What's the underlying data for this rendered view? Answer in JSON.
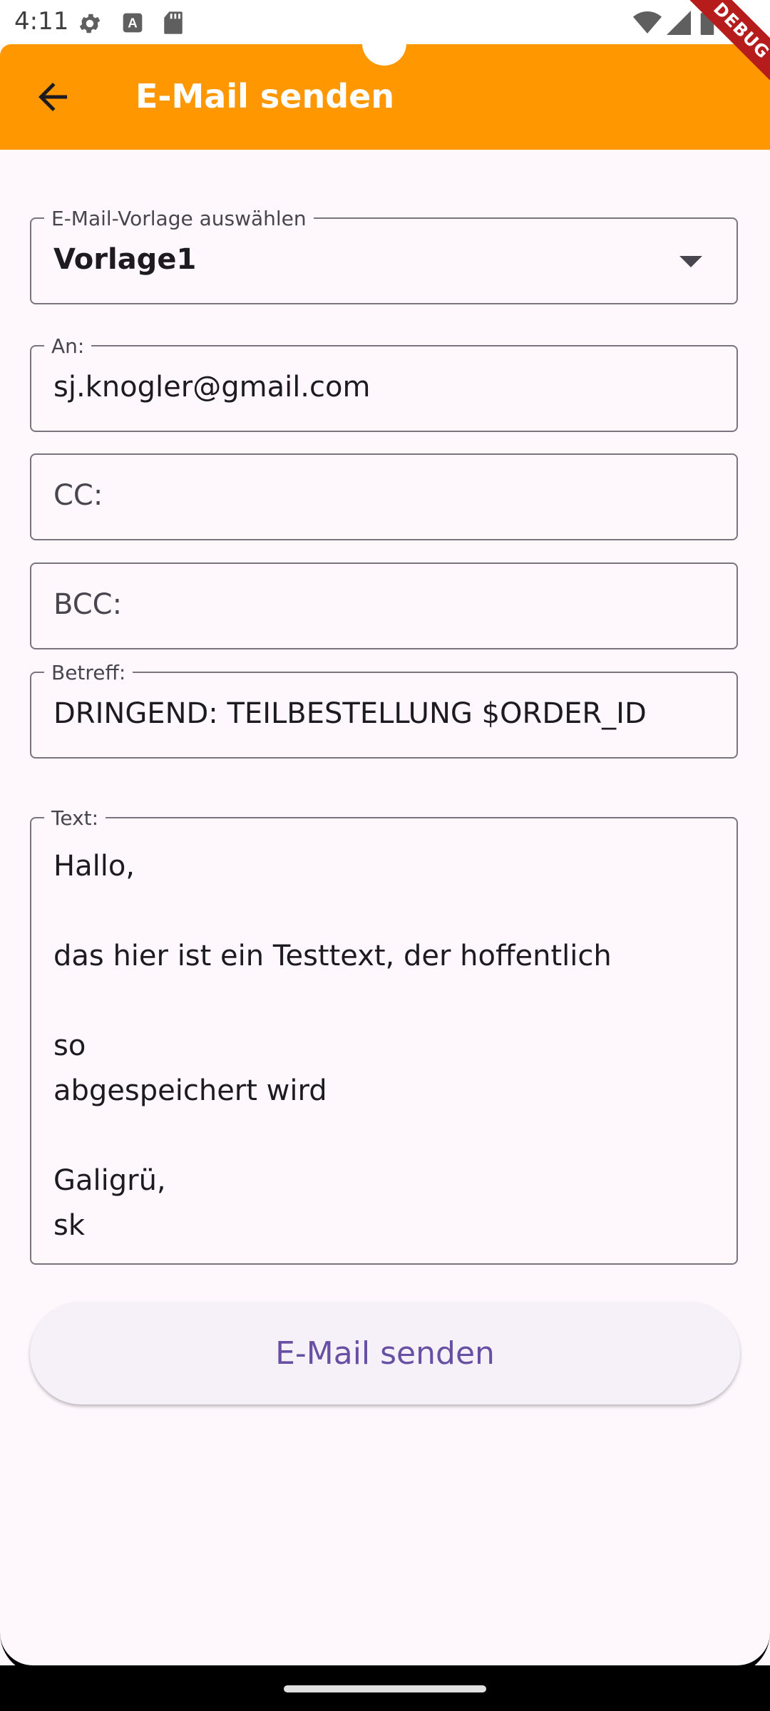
{
  "status_bar": {
    "time": "4:11",
    "icons": [
      "settings-icon",
      "a-icon",
      "sd-card-icon",
      "wifi-icon",
      "signal-icon",
      "battery-icon"
    ]
  },
  "debug_banner": "DEBUG",
  "app_bar": {
    "title": "E-Mail senden",
    "back_icon": "arrow-back-icon",
    "color": "#ff9800"
  },
  "form": {
    "template": {
      "label": "E-Mail-Vorlage auswählen",
      "value": "Vorlage1"
    },
    "to": {
      "label": "An:",
      "value": "sj.knogler@gmail.com"
    },
    "cc": {
      "placeholder": "CC:"
    },
    "bcc": {
      "placeholder": "BCC:"
    },
    "subject": {
      "label": "Betreff:",
      "value": "DRINGEND: TEILBESTELLUNG $ORDER_ID"
    },
    "body": {
      "label": "Text:",
      "value": "Hallo,\n\ndas hier ist ein Testtext, der hoffentlich\n\nso\nabgespeichert wird\n\nGaligrü,\nsk"
    }
  },
  "send_button": {
    "label": "E-Mail senden",
    "color": "#6750a4"
  }
}
